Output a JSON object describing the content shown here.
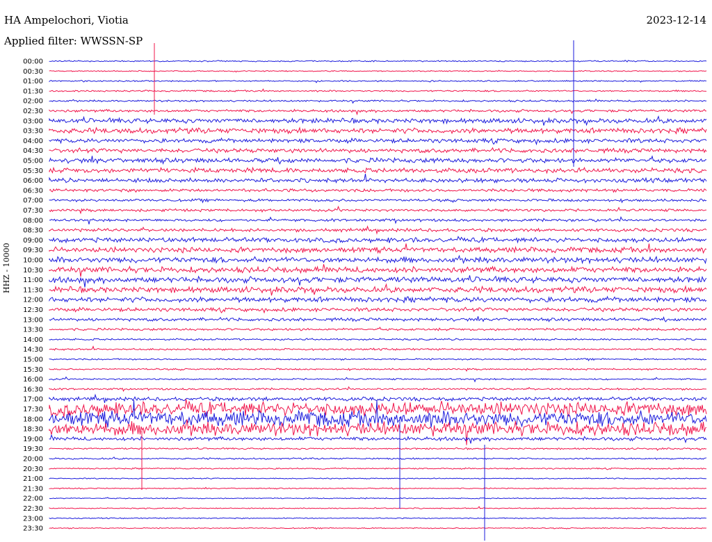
{
  "header": {
    "station": "HA Ampelochori, Viotia",
    "date": "2023-12-14",
    "filter": "Applied filter: WWSSN-SP"
  },
  "axis": {
    "channel_label": "HHZ - 10000"
  },
  "colors": {
    "trace_a": "#1a1adc",
    "trace_b": "#f0144a"
  },
  "chart_data": {
    "type": "line",
    "title": "HA Ampelochori, Viotia",
    "xlabel": "",
    "ylabel": "HHZ - 10000",
    "grid": false,
    "legend": "none",
    "row_labels": [
      "00:00",
      "00:30",
      "01:00",
      "01:30",
      "02:00",
      "02:30",
      "03:00",
      "03:30",
      "04:00",
      "04:30",
      "05:00",
      "05:30",
      "06:00",
      "06:30",
      "07:00",
      "07:30",
      "08:00",
      "08:30",
      "09:00",
      "09:30",
      "10:00",
      "10:30",
      "11:00",
      "11:30",
      "12:00",
      "12:30",
      "13:00",
      "13:30",
      "14:00",
      "14:30",
      "15:00",
      "15:30",
      "16:00",
      "16:30",
      "17:00",
      "17:30",
      "18:00",
      "18:30",
      "19:00",
      "19:30",
      "20:00",
      "20:30",
      "21:00",
      "21:30",
      "22:00",
      "22:30",
      "23:00",
      "23:30"
    ],
    "activity": [
      0.25,
      0.2,
      0.25,
      0.3,
      0.35,
      0.5,
      0.9,
      1.0,
      0.8,
      0.8,
      0.9,
      0.9,
      0.8,
      0.6,
      0.5,
      0.5,
      0.5,
      0.6,
      0.9,
      1.0,
      1.1,
      1.1,
      1.1,
      1.1,
      1.0,
      0.7,
      0.6,
      0.45,
      0.35,
      0.35,
      0.3,
      0.3,
      0.3,
      0.35,
      0.7,
      2.6,
      2.9,
      2.6,
      0.7,
      0.3,
      0.3,
      0.25,
      0.2,
      0.2,
      0.2,
      0.2,
      0.2,
      0.2
    ]
  }
}
